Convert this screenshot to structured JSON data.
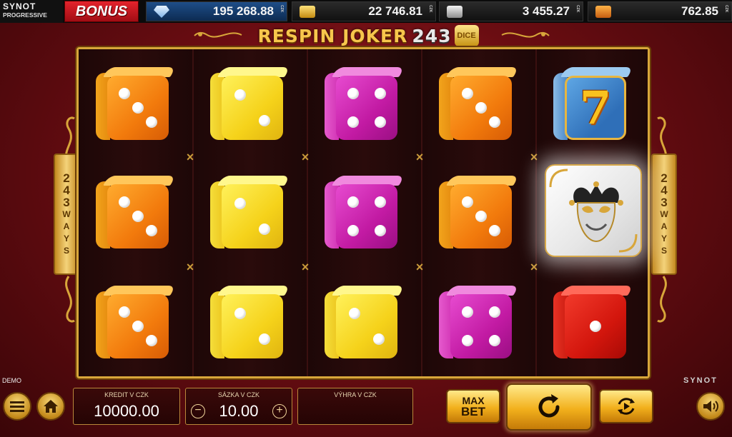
{
  "topbar": {
    "brand_top": "SYNOT",
    "brand_bottom": "PROGRESSIVE",
    "bonus_label": "BONUS",
    "jackpots": [
      {
        "icon": "diamond-icon",
        "value": "195 268.88",
        "currency": "CZK"
      },
      {
        "icon": "gold-bar-icon",
        "value": "22 746.81",
        "currency": "CZK"
      },
      {
        "icon": "silver-bar-icon",
        "value": "3 455.27",
        "currency": "CZK"
      },
      {
        "icon": "bronze-bar-icon",
        "value": "762.85",
        "currency": "CZK"
      }
    ]
  },
  "game": {
    "title": "RESPIN JOKER",
    "title_number": "243",
    "title_badge": "DICE",
    "ways_number": [
      "2",
      "4",
      "3"
    ],
    "ways_label": [
      "W",
      "A",
      "Y",
      "S"
    ]
  },
  "reels": [
    [
      {
        "symbol": "orange-die",
        "pips": 3
      },
      {
        "symbol": "orange-die",
        "pips": 3
      },
      {
        "symbol": "orange-die",
        "pips": 3
      }
    ],
    [
      {
        "symbol": "yellow-die",
        "pips": 2
      },
      {
        "symbol": "yellow-die",
        "pips": 2
      },
      {
        "symbol": "yellow-die",
        "pips": 2
      }
    ],
    [
      {
        "symbol": "magenta-die",
        "pips": 4
      },
      {
        "symbol": "magenta-die",
        "pips": 4
      },
      {
        "symbol": "yellow-die",
        "pips": 2
      }
    ],
    [
      {
        "symbol": "orange-die",
        "pips": 3
      },
      {
        "symbol": "orange-die",
        "pips": 3
      },
      {
        "symbol": "magenta-die",
        "pips": 4
      }
    ],
    [
      {
        "symbol": "seven-die",
        "pips": 0
      },
      {
        "symbol": "joker-die",
        "pips": 0
      },
      {
        "symbol": "red-die",
        "pips": 1
      }
    ]
  ],
  "colors": {
    "orange": "#f27a0c",
    "yellow": "#f5d21a",
    "magenta": "#c21aa3",
    "red": "#d3160d",
    "blue": "#2f6fb8",
    "gold": "#d8a63a",
    "background": "#6b0d12"
  },
  "footer": {
    "demo_label": "DEMO",
    "brand": "SYNOT",
    "credit_label": "KREDIT V CZK",
    "credit_value": "10000.00",
    "bet_label": "SÁZKA V CZK",
    "bet_value": "10.00",
    "bet_decrease": "−",
    "bet_increase": "+",
    "win_label": "VÝHRA V CZK",
    "win_value": "",
    "max_bet_line1": "MAX",
    "max_bet_line2": "BET"
  }
}
